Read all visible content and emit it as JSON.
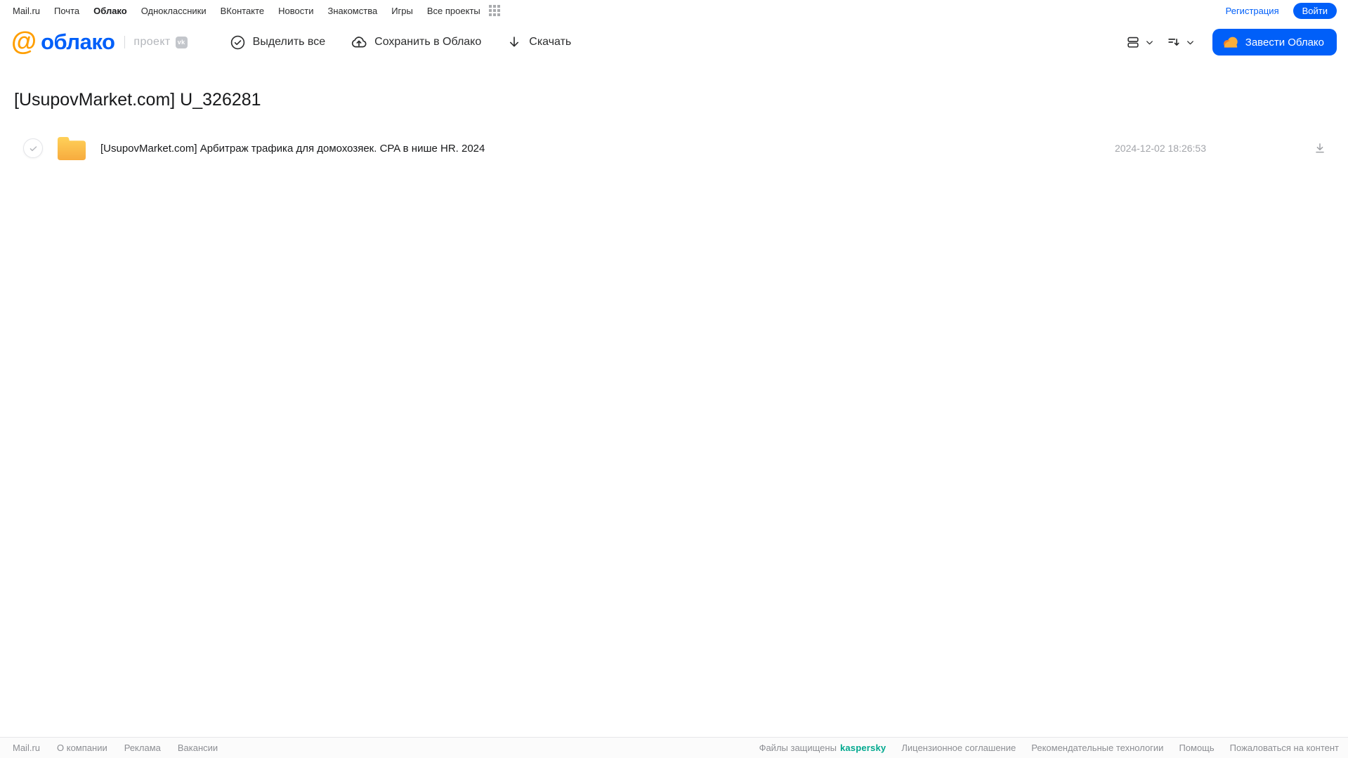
{
  "topbar": {
    "links": [
      "Mail.ru",
      "Почта",
      "Облако",
      "Одноклассники",
      "ВКонтакте",
      "Новости",
      "Знакомства",
      "Игры",
      "Все проекты"
    ],
    "active_link": "Облако",
    "registration_label": "Регистрация",
    "login_label": "Войти"
  },
  "header": {
    "logo_at": "@",
    "logo_text": "облако",
    "project_label": "проект",
    "vk_badge": "vk",
    "toolbar": {
      "select_all": "Выделить все",
      "save_to_cloud": "Сохранить в Облако",
      "download": "Скачать"
    },
    "create_cloud_label": "Завести Облако"
  },
  "main": {
    "title": "[UsupovMarket.com] U_326281",
    "rows": [
      {
        "type": "folder",
        "name": "[UsupovMarket.com] Арбитраж трафика для домохозяек. CPA в нише HR. 2024",
        "date": "2024-12-02 18:26:53"
      }
    ]
  },
  "footer": {
    "left_links": [
      "Mail.ru",
      "О компании",
      "Реклама",
      "Вакансии"
    ],
    "protected_label": "Файлы защищены",
    "kaspersky_label": "kaspersky",
    "right_links": [
      "Лицензионное соглашение",
      "Рекомендательные технологии",
      "Помощь",
      "Пожаловаться на контент"
    ]
  },
  "colors": {
    "brand_blue": "#005FF9",
    "brand_orange": "#FF9E00",
    "kaspersky_green": "#00A88E",
    "folder_yellow": "#FFC94A",
    "text_dark": "#2C2D2E",
    "text_gray": "#9FA1A6"
  }
}
